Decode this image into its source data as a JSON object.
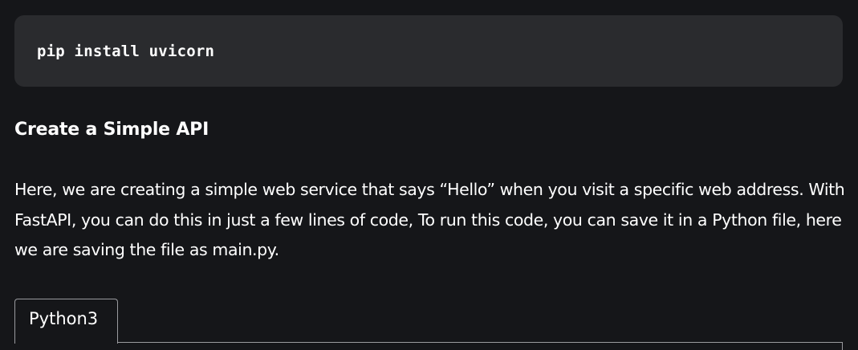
{
  "code_block": {
    "command": "pip install uvicorn"
  },
  "section": {
    "heading": "Create a Simple API",
    "paragraph": "Here, we are creating a simple web service that says “Hello” when you visit a specific web address. With FastAPI, you can do this in just a few lines of code, To run this code, you can save it in a Python file, here we are saving the file as main.py."
  },
  "code_tabs": {
    "active_tab_label": "Python3"
  }
}
